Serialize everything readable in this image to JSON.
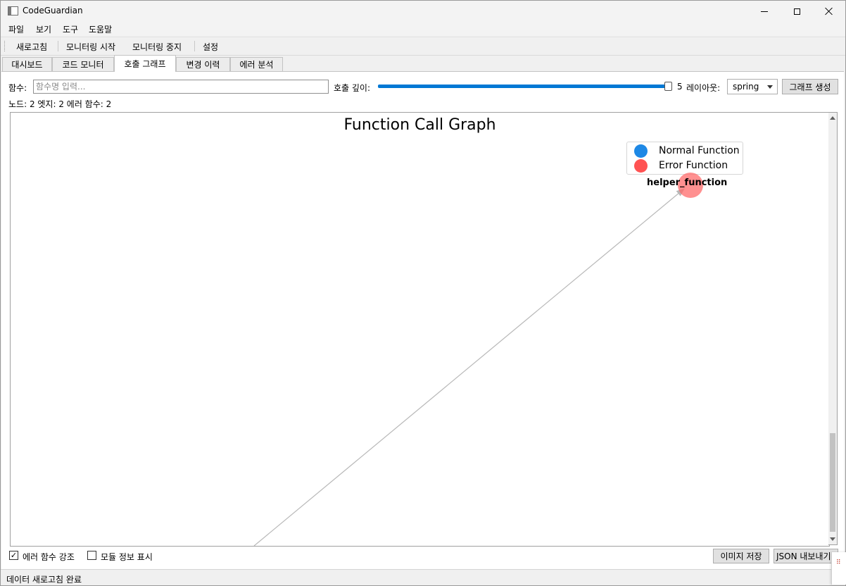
{
  "window": {
    "title": "CodeGuardian"
  },
  "menu": [
    "파일",
    "보기",
    "도구",
    "도움말"
  ],
  "toolbar": {
    "refresh": "새로고침",
    "start_monitoring": "모니터링 시작",
    "stop_monitoring": "모니터링 중지",
    "settings": "설정"
  },
  "tabs": [
    "대시보드",
    "코드 모니터",
    "호출 그래프",
    "변경 이력",
    "에러 분석"
  ],
  "active_tab": "호출 그래프",
  "controls": {
    "function_label": "함수:",
    "function_placeholder": "함수명 입력...",
    "function_value": "",
    "depth_label": "호출 깊이:",
    "depth_value": "5",
    "depth_max": "5",
    "layout_label": "레이아웃:",
    "layout_value": "spring",
    "generate_button": "그래프 생성"
  },
  "stats": "노드: 2 엣지: 2 에러 함수: 2",
  "graph": {
    "title": "Function Call Graph",
    "legend": [
      {
        "label": "Normal Function",
        "color": "#1e88e5"
      },
      {
        "label": "Error Function",
        "color": "#ff5252"
      }
    ],
    "node_label": "helper_function",
    "node_color": "#ff6b6b",
    "edge_color": "#b8b8b8"
  },
  "options": {
    "highlight_errors_label": "에러 함수 강조",
    "highlight_errors_checked": true,
    "show_module_label": "모듈 정보 표시",
    "show_module_checked": false
  },
  "export": {
    "save_image": "이미지 저장",
    "export_json": "JSON 내보내기"
  },
  "status": "데이터 새로고침 완료"
}
